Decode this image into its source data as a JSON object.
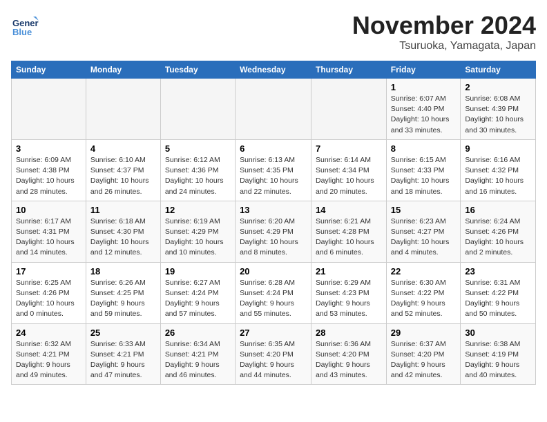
{
  "header": {
    "logo_general": "General",
    "logo_blue": "Blue",
    "month_title": "November 2024",
    "location": "Tsuruoka, Yamagata, Japan"
  },
  "days_of_week": [
    "Sunday",
    "Monday",
    "Tuesday",
    "Wednesday",
    "Thursday",
    "Friday",
    "Saturday"
  ],
  "weeks": [
    [
      {
        "day": "",
        "info": ""
      },
      {
        "day": "",
        "info": ""
      },
      {
        "day": "",
        "info": ""
      },
      {
        "day": "",
        "info": ""
      },
      {
        "day": "",
        "info": ""
      },
      {
        "day": "1",
        "info": "Sunrise: 6:07 AM\nSunset: 4:40 PM\nDaylight: 10 hours and 33 minutes."
      },
      {
        "day": "2",
        "info": "Sunrise: 6:08 AM\nSunset: 4:39 PM\nDaylight: 10 hours and 30 minutes."
      }
    ],
    [
      {
        "day": "3",
        "info": "Sunrise: 6:09 AM\nSunset: 4:38 PM\nDaylight: 10 hours and 28 minutes."
      },
      {
        "day": "4",
        "info": "Sunrise: 6:10 AM\nSunset: 4:37 PM\nDaylight: 10 hours and 26 minutes."
      },
      {
        "day": "5",
        "info": "Sunrise: 6:12 AM\nSunset: 4:36 PM\nDaylight: 10 hours and 24 minutes."
      },
      {
        "day": "6",
        "info": "Sunrise: 6:13 AM\nSunset: 4:35 PM\nDaylight: 10 hours and 22 minutes."
      },
      {
        "day": "7",
        "info": "Sunrise: 6:14 AM\nSunset: 4:34 PM\nDaylight: 10 hours and 20 minutes."
      },
      {
        "day": "8",
        "info": "Sunrise: 6:15 AM\nSunset: 4:33 PM\nDaylight: 10 hours and 18 minutes."
      },
      {
        "day": "9",
        "info": "Sunrise: 6:16 AM\nSunset: 4:32 PM\nDaylight: 10 hours and 16 minutes."
      }
    ],
    [
      {
        "day": "10",
        "info": "Sunrise: 6:17 AM\nSunset: 4:31 PM\nDaylight: 10 hours and 14 minutes."
      },
      {
        "day": "11",
        "info": "Sunrise: 6:18 AM\nSunset: 4:30 PM\nDaylight: 10 hours and 12 minutes."
      },
      {
        "day": "12",
        "info": "Sunrise: 6:19 AM\nSunset: 4:29 PM\nDaylight: 10 hours and 10 minutes."
      },
      {
        "day": "13",
        "info": "Sunrise: 6:20 AM\nSunset: 4:29 PM\nDaylight: 10 hours and 8 minutes."
      },
      {
        "day": "14",
        "info": "Sunrise: 6:21 AM\nSunset: 4:28 PM\nDaylight: 10 hours and 6 minutes."
      },
      {
        "day": "15",
        "info": "Sunrise: 6:23 AM\nSunset: 4:27 PM\nDaylight: 10 hours and 4 minutes."
      },
      {
        "day": "16",
        "info": "Sunrise: 6:24 AM\nSunset: 4:26 PM\nDaylight: 10 hours and 2 minutes."
      }
    ],
    [
      {
        "day": "17",
        "info": "Sunrise: 6:25 AM\nSunset: 4:26 PM\nDaylight: 10 hours and 0 minutes."
      },
      {
        "day": "18",
        "info": "Sunrise: 6:26 AM\nSunset: 4:25 PM\nDaylight: 9 hours and 59 minutes."
      },
      {
        "day": "19",
        "info": "Sunrise: 6:27 AM\nSunset: 4:24 PM\nDaylight: 9 hours and 57 minutes."
      },
      {
        "day": "20",
        "info": "Sunrise: 6:28 AM\nSunset: 4:24 PM\nDaylight: 9 hours and 55 minutes."
      },
      {
        "day": "21",
        "info": "Sunrise: 6:29 AM\nSunset: 4:23 PM\nDaylight: 9 hours and 53 minutes."
      },
      {
        "day": "22",
        "info": "Sunrise: 6:30 AM\nSunset: 4:22 PM\nDaylight: 9 hours and 52 minutes."
      },
      {
        "day": "23",
        "info": "Sunrise: 6:31 AM\nSunset: 4:22 PM\nDaylight: 9 hours and 50 minutes."
      }
    ],
    [
      {
        "day": "24",
        "info": "Sunrise: 6:32 AM\nSunset: 4:21 PM\nDaylight: 9 hours and 49 minutes."
      },
      {
        "day": "25",
        "info": "Sunrise: 6:33 AM\nSunset: 4:21 PM\nDaylight: 9 hours and 47 minutes."
      },
      {
        "day": "26",
        "info": "Sunrise: 6:34 AM\nSunset: 4:21 PM\nDaylight: 9 hours and 46 minutes."
      },
      {
        "day": "27",
        "info": "Sunrise: 6:35 AM\nSunset: 4:20 PM\nDaylight: 9 hours and 44 minutes."
      },
      {
        "day": "28",
        "info": "Sunrise: 6:36 AM\nSunset: 4:20 PM\nDaylight: 9 hours and 43 minutes."
      },
      {
        "day": "29",
        "info": "Sunrise: 6:37 AM\nSunset: 4:20 PM\nDaylight: 9 hours and 42 minutes."
      },
      {
        "day": "30",
        "info": "Sunrise: 6:38 AM\nSunset: 4:19 PM\nDaylight: 9 hours and 40 minutes."
      }
    ]
  ]
}
